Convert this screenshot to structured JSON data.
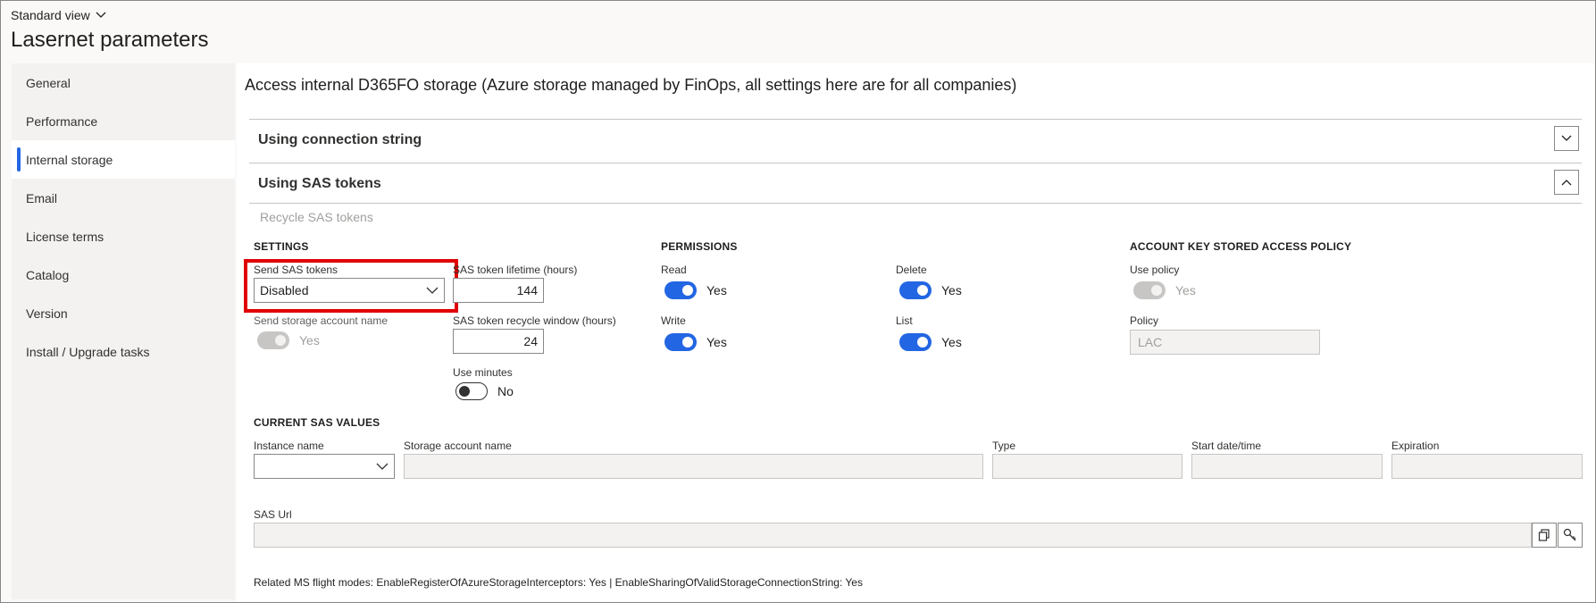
{
  "header": {
    "view_label": "Standard view",
    "title": "Lasernet parameters"
  },
  "sidebar": {
    "items": [
      {
        "label": "General"
      },
      {
        "label": "Performance"
      },
      {
        "label": "Internal storage"
      },
      {
        "label": "Email"
      },
      {
        "label": "License terms"
      },
      {
        "label": "Catalog"
      },
      {
        "label": "Version"
      },
      {
        "label": "Install / Upgrade tasks"
      }
    ],
    "active": "Internal storage"
  },
  "main": {
    "section_title": "Access internal D365FO storage (Azure storage managed by FinOps, all settings here are for all companies)",
    "fasttabs": [
      {
        "label": "Using connection string",
        "expanded": false
      },
      {
        "label": "Using SAS tokens",
        "expanded": true
      }
    ],
    "action_recycle": "Recycle SAS tokens",
    "settings": {
      "header": "SETTINGS",
      "send_sas_tokens_label": "Send SAS tokens",
      "send_sas_tokens_value": "Disabled",
      "send_storage_account_label": "Send storage account name",
      "send_storage_account_value": "Yes",
      "lifetime_label": "SAS token lifetime (hours)",
      "lifetime_value": "144",
      "recycle_window_label": "SAS token recycle window (hours)",
      "recycle_window_value": "24",
      "use_minutes_label": "Use minutes",
      "use_minutes_value": "No"
    },
    "permissions": {
      "header": "PERMISSIONS",
      "read_label": "Read",
      "read_value": "Yes",
      "delete_label": "Delete",
      "delete_value": "Yes",
      "write_label": "Write",
      "write_value": "Yes",
      "list_label": "List",
      "list_value": "Yes"
    },
    "policy": {
      "header": "ACCOUNT KEY STORED ACCESS POLICY",
      "use_policy_label": "Use policy",
      "use_policy_value": "Yes",
      "policy_label": "Policy",
      "policy_value": "LAC"
    },
    "current": {
      "header": "CURRENT SAS VALUES",
      "instance_label": "Instance name",
      "storage_label": "Storage account name",
      "type_label": "Type",
      "start_label": "Start date/time",
      "expiration_label": "Expiration",
      "sas_url_label": "SAS Url"
    },
    "footer_note": "Related MS flight modes: EnableRegisterOfAzureStorageInterceptors: Yes | EnableSharingOfValidStorageConnectionString: Yes"
  },
  "colors": {
    "accent": "#2266e3",
    "highlight": "#e00000"
  },
  "icons": [
    "chevron-down-icon",
    "chevron-up-icon",
    "copy-icon",
    "key-icon"
  ]
}
